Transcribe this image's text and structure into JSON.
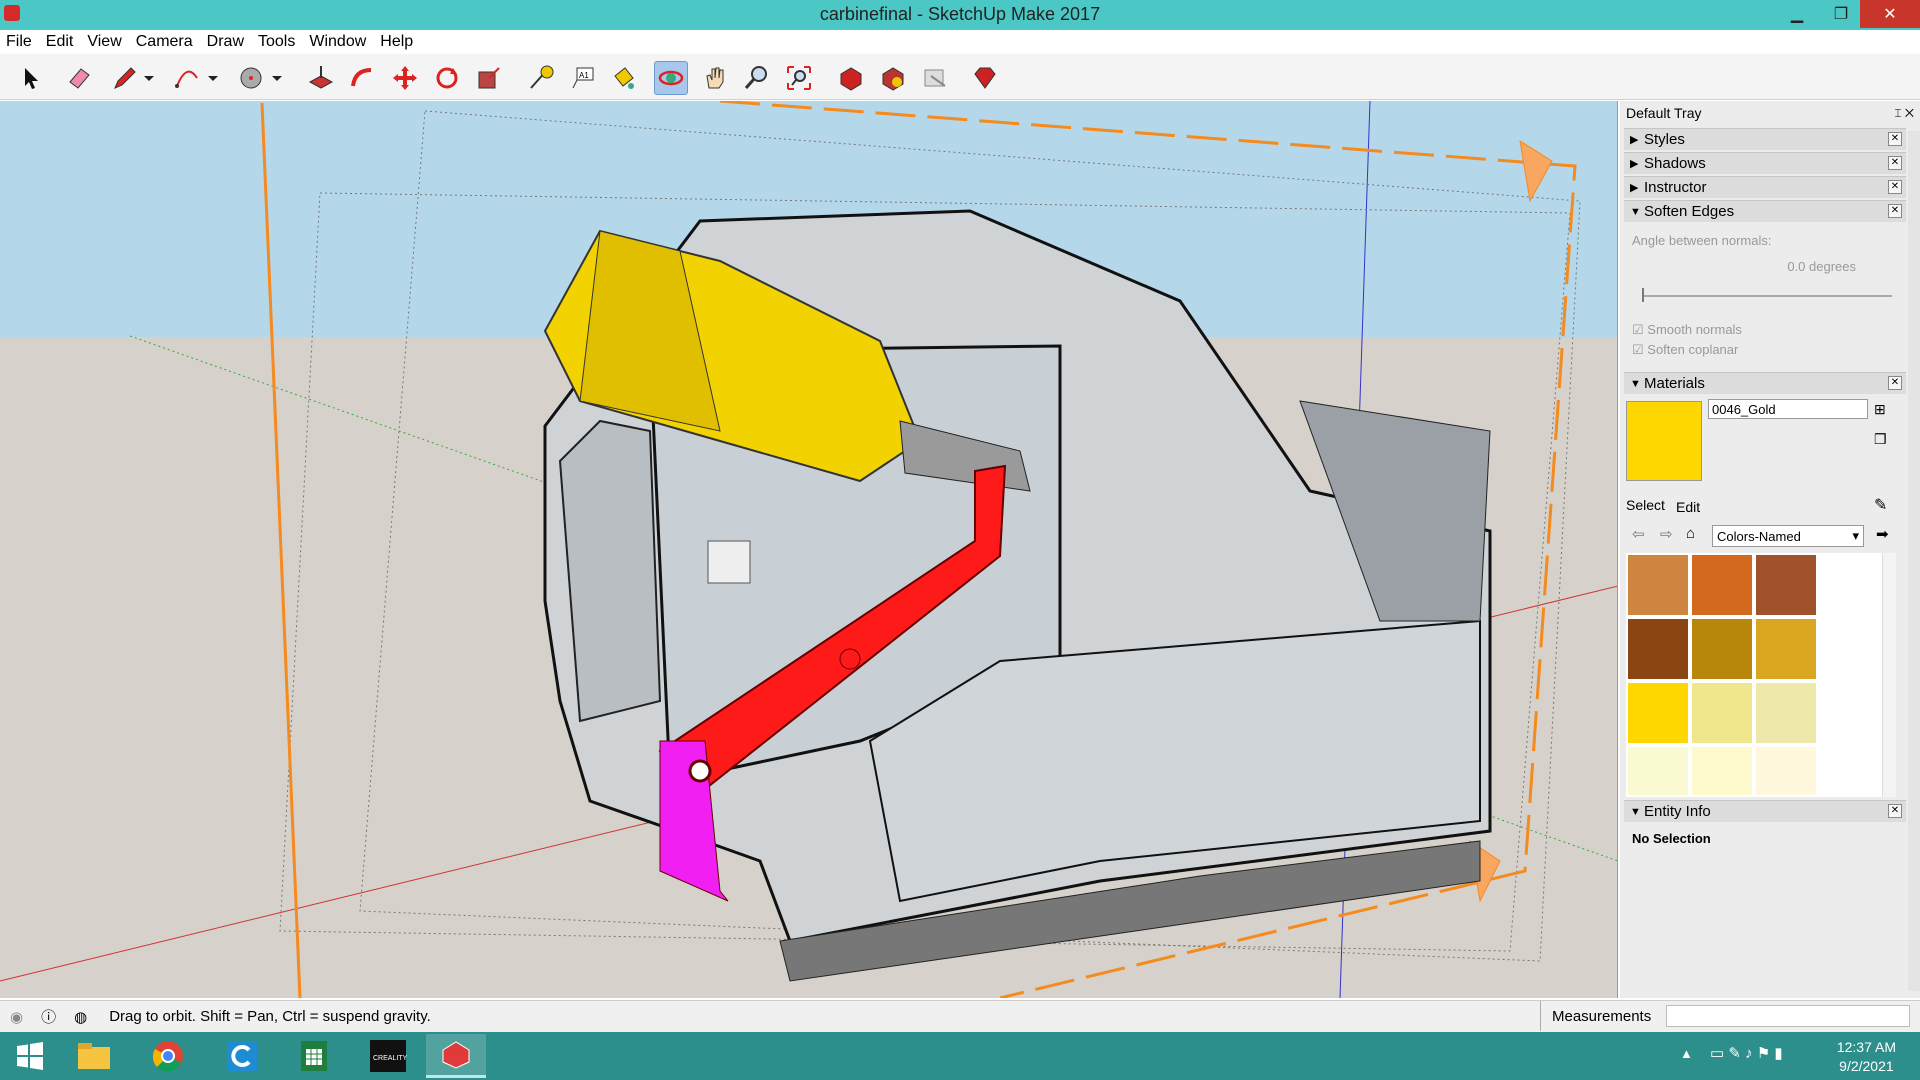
{
  "window": {
    "title": "carbinefinal - SketchUp Make 2017",
    "minimize": "▁",
    "maximize": "❐",
    "close": "✕"
  },
  "menu": [
    "File",
    "Edit",
    "View",
    "Camera",
    "Draw",
    "Tools",
    "Window",
    "Help"
  ],
  "toolbar": {
    "tools": [
      "select",
      "eraser",
      "pencil",
      "arc",
      "shapes",
      "push-pull",
      "follow-me",
      "move",
      "rotate",
      "scale",
      "tape-measure",
      "text",
      "paint-bucket",
      "orbit",
      "pan",
      "zoom",
      "zoom-extents",
      "3d-warehouse",
      "extension-warehouse",
      "layout",
      "ruby"
    ],
    "active": "orbit"
  },
  "tray": {
    "title": "Default Tray",
    "panels": [
      {
        "label": "Styles",
        "expanded": false
      },
      {
        "label": "Shadows",
        "expanded": false
      },
      {
        "label": "Instructor",
        "expanded": false
      },
      {
        "label": "Soften Edges",
        "expanded": true
      }
    ],
    "soften": {
      "angle_label": "Angle between normals:",
      "angle_value": "0.0  degrees",
      "slider_value": 0,
      "smooth_normals": "Smooth normals",
      "soften_coplanar": "Soften coplanar"
    },
    "materials": {
      "label": "Materials",
      "name": "0046_Gold",
      "current_color": "#ffd700",
      "tab_select": "Select",
      "tab_edit": "Edit",
      "library": "Colors-Named",
      "swatches": [
        "#cd853f",
        "#d2691e",
        "#a0522d",
        "#8b4513",
        "#b8860b",
        "#daa520",
        "#ffd700",
        "#f0e68c",
        "#eee8aa",
        "#fafad2",
        "#fffacd",
        "#fff8dc"
      ]
    },
    "entity": {
      "label": "Entity Info",
      "value": "No Selection"
    }
  },
  "status": {
    "message": "Drag to orbit. Shift = Pan, Ctrl = suspend gravity.",
    "measurements_label": "Measurements",
    "measurements_value": ""
  },
  "taskbar": {
    "apps": [
      "start",
      "file-explorer",
      "chrome",
      "ccleaner",
      "sheets",
      "creality",
      "sketchup"
    ],
    "time": "12:37 AM",
    "date": "9/2/2021"
  },
  "colors": {
    "titlebar": "#4bc8c5",
    "taskbar": "#2d8f8c",
    "sky": "#b7d8ea",
    "ground": "#d6d2ca"
  }
}
